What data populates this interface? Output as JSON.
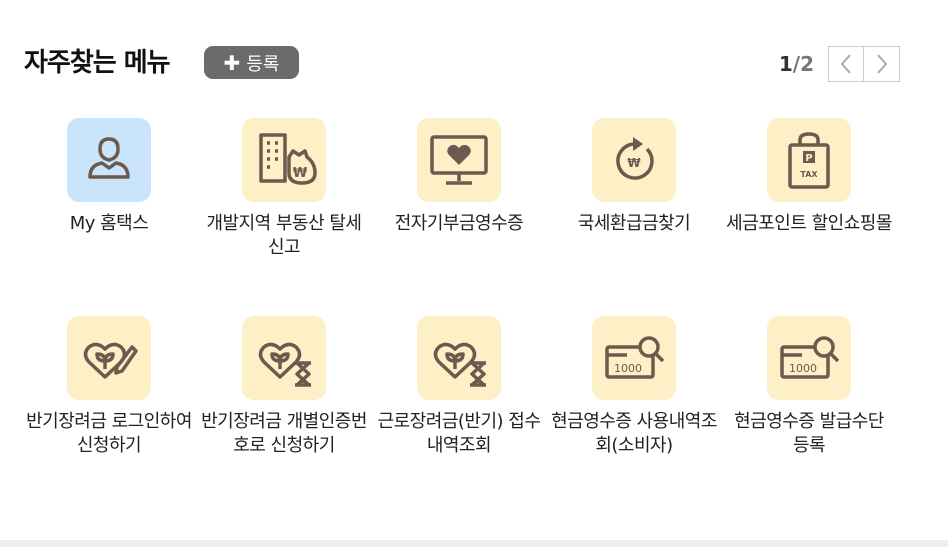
{
  "header": {
    "title": "자주찾는 메뉴",
    "add_button_label": "등록",
    "page_current": "1",
    "page_total": "/2"
  },
  "menu_items": [
    {
      "label": "My 홈택스",
      "icon": "person-icon"
    },
    {
      "label": "개발지역 부동산 탈세신고",
      "icon": "building-money-bag-icon"
    },
    {
      "label": "전자기부금영수증",
      "icon": "monitor-heart-icon"
    },
    {
      "label": "국세환급금찾기",
      "icon": "won-refund-icon"
    },
    {
      "label": "세금포인트 할인쇼핑몰",
      "icon": "shopping-bag-tax-icon"
    },
    {
      "label": "반기장려금 로그인하여 신청하기",
      "icon": "heart-sprout-pencil-icon"
    },
    {
      "label": "반기장려금 개별인증번호로 신청하기",
      "icon": "heart-sprout-hourglass-icon"
    },
    {
      "label": "근로장려금(반기) 접수내역조회",
      "icon": "heart-sprout-hourglass-icon"
    },
    {
      "label": "현금영수증 사용내역조회(소비자)",
      "icon": "receipt-magnifier-icon"
    },
    {
      "label": "현금영수증 발급수단 등록",
      "icon": "receipt-magnifier-icon"
    }
  ],
  "icon_texts": {
    "won": "₩",
    "p": "P",
    "tax": "TAX",
    "amount": "1000"
  },
  "colors": {
    "icon_bg": "#fdf0c6",
    "icon_bg_blue": "#c9e4fb",
    "icon_stroke": "#6b5a4e",
    "button_bg": "#6b6b6b"
  }
}
